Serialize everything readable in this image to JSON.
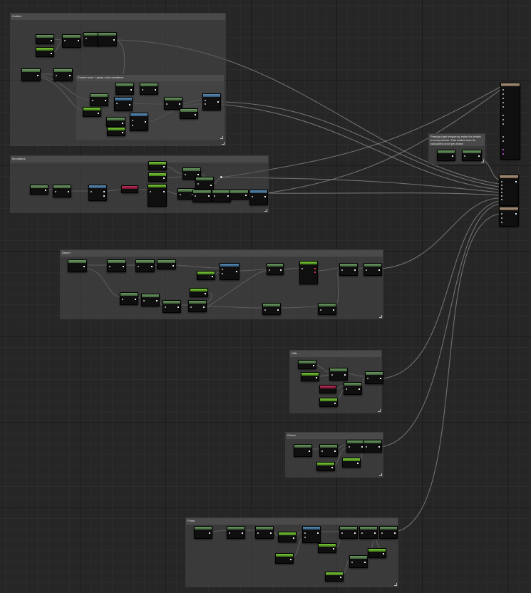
{
  "comments": [
    {
      "id": "craters",
      "title": "Craters"
    },
    {
      "id": "forest-variations",
      "title": "Forest noise + grass color variations"
    },
    {
      "id": "mountains",
      "title": "Mountains"
    },
    {
      "id": "desert",
      "title": "Desert"
    },
    {
      "id": "hills",
      "title": "Hills"
    },
    {
      "id": "ocean",
      "title": "Ocean"
    },
    {
      "id": "poles",
      "title": "Poles"
    },
    {
      "id": "detail-noise",
      "title": "Passing high frequency noise for details to every biome. This makes sure its calculated once per-make"
    }
  ],
  "colors": {
    "background": "#262626",
    "comment_bg": "#4a4a4a",
    "node_body": "#0f0f0f",
    "header_green": "#6c9a63",
    "header_lime": "#7fcc3a",
    "header_blue": "#5c8fb8",
    "header_red": "#c0325a",
    "header_tan": "#b79e85",
    "wire": "#8a8a8a"
  }
}
